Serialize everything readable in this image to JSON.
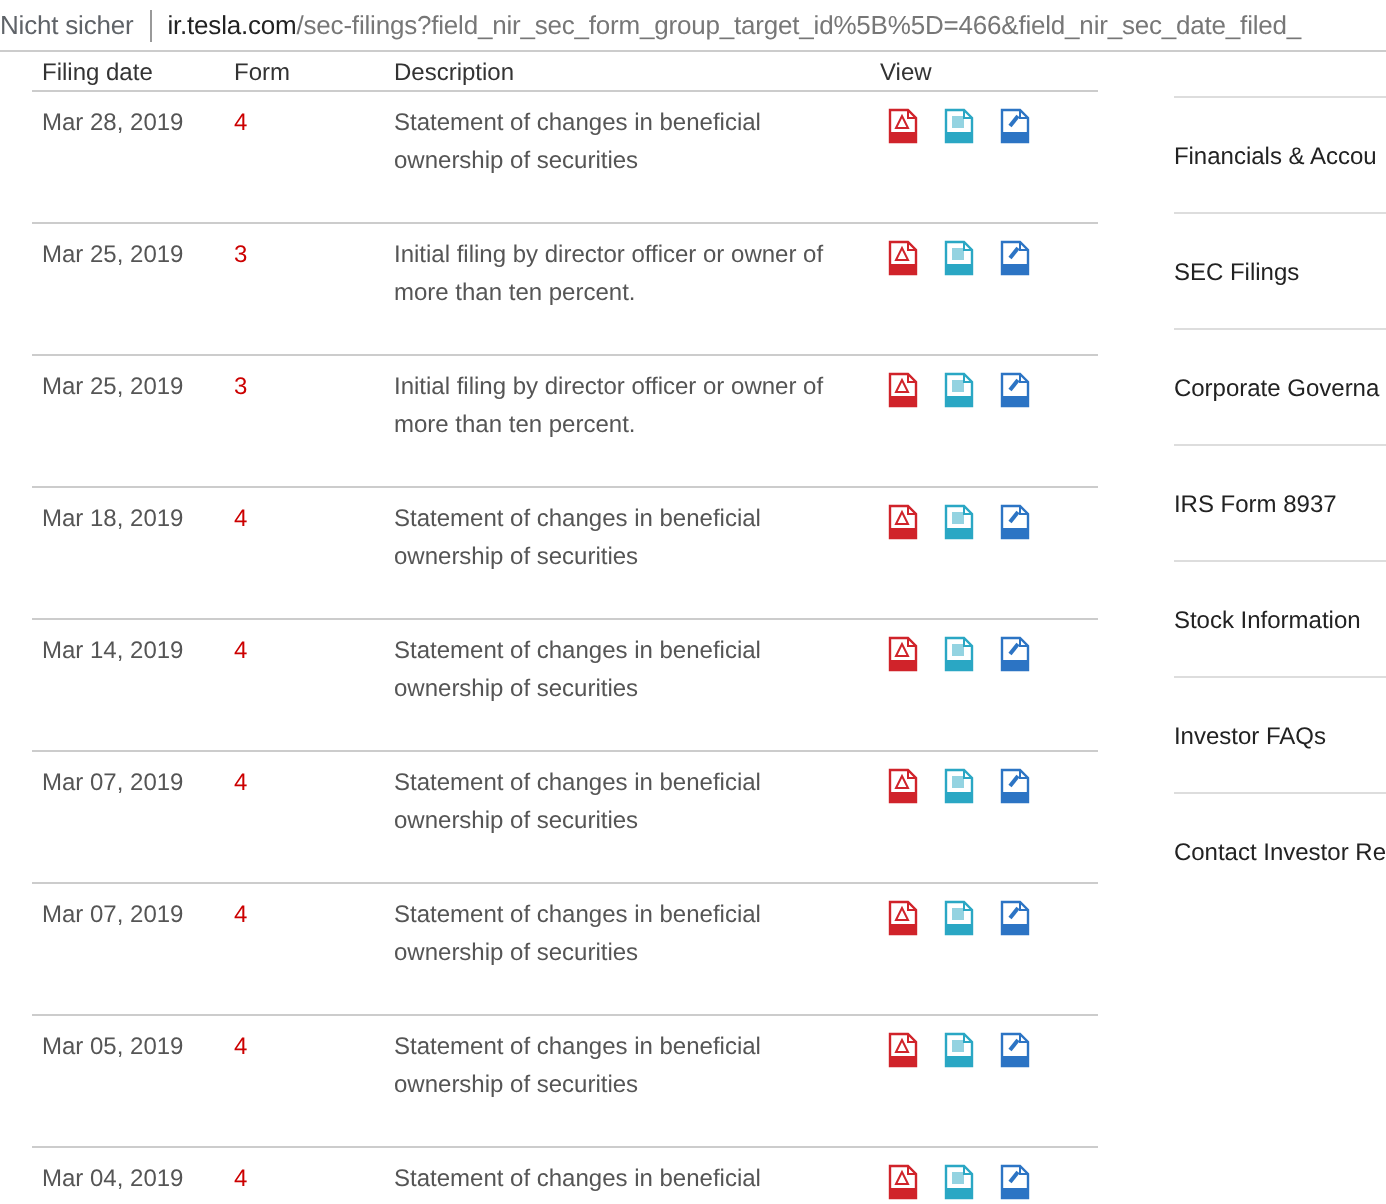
{
  "address_bar": {
    "security": "Nicht sicher",
    "host": "ir.tesla.com",
    "path": "/sec-filings?field_nir_sec_form_group_target_id%5B%5D=466&field_nir_sec_date_filed_"
  },
  "table": {
    "columns": [
      "Filing date",
      "Form",
      "Description",
      "View"
    ],
    "rows": [
      {
        "date": "Mar 28, 2019",
        "form": "4",
        "description": "Statement of changes in beneficial ownership of securities"
      },
      {
        "date": "Mar 25, 2019",
        "form": "3",
        "description": "Initial filing by director officer or owner of more than ten percent."
      },
      {
        "date": "Mar 25, 2019",
        "form": "3",
        "description": "Initial filing by director officer or owner of more than ten percent."
      },
      {
        "date": "Mar 18, 2019",
        "form": "4",
        "description": "Statement of changes in beneficial ownership of securities"
      },
      {
        "date": "Mar 14, 2019",
        "form": "4",
        "description": "Statement of changes in beneficial ownership of securities"
      },
      {
        "date": "Mar 07, 2019",
        "form": "4",
        "description": "Statement of changes in beneficial ownership of securities"
      },
      {
        "date": "Mar 07, 2019",
        "form": "4",
        "description": "Statement of changes in beneficial ownership of securities"
      },
      {
        "date": "Mar 05, 2019",
        "form": "4",
        "description": "Statement of changes in beneficial ownership of securities"
      },
      {
        "date": "Mar 04, 2019",
        "form": "4",
        "description": "Statement of changes in beneficial"
      }
    ]
  },
  "sidebar": {
    "items": [
      "Financials & Accou",
      "SEC Filings",
      "Corporate Governa",
      "IRS Form 8937",
      "Stock Information",
      "Investor FAQs",
      "Contact Investor Re"
    ]
  }
}
